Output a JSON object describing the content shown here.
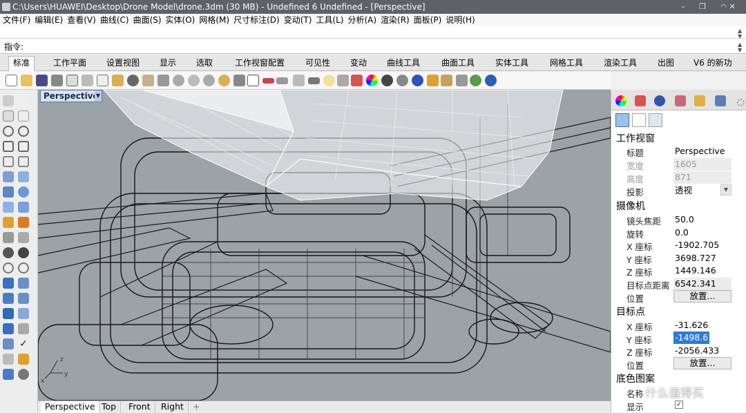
{
  "window": {
    "title": "C:\\Users\\HUAWEI\\Desktop\\Drone Model\\drone.3dm (30 MB) - Undefined 6 Undefined - [Perspective]",
    "controls": [
      "–",
      "❐",
      "✕"
    ]
  },
  "menu": [
    "文件(F)",
    "编辑(E)",
    "查看(V)",
    "曲线(C)",
    "曲面(S)",
    "实体(O)",
    "网格(M)",
    "尺寸标注(D)",
    "变动(T)",
    "工具(L)",
    "分析(A)",
    "渲染(R)",
    "面板(P)",
    "说明(H)"
  ],
  "command": {
    "label": "指令:",
    "value": ""
  },
  "ribbon_tabs": [
    "标准",
    "工作平面",
    "设置视图",
    "显示",
    "选取",
    "工作视窗配置",
    "可见性",
    "变动",
    "曲线工具",
    "曲面工具",
    "实体工具",
    "网格工具",
    "渲染工具",
    "出图",
    "V6 的新功"
  ],
  "toolbar_icons": [
    "new-icon",
    "open-icon",
    "save-icon",
    "print-icon",
    "import-icon",
    "cut-icon",
    "copy-icon",
    "paste-icon",
    "undo-icon",
    "pan-icon",
    "rotate-icon",
    "zoom-icon",
    "zoom-window-icon",
    "zoom-extents-icon",
    "zoom-selected-icon",
    "rotate-view-icon",
    "viewports-icon",
    "cplane-icon",
    "car-icon",
    "select-icon",
    "hide-icon",
    "light-icon",
    "lock-icon",
    "layer-icon",
    "color-wheel-icon",
    "sphere-render-icon",
    "material-icon",
    "globe-icon",
    "flag-icon",
    "gear-puzzle-icon",
    "dim-icon",
    "earth-icon",
    "help-icon"
  ],
  "viewport": {
    "name": "Perspective",
    "axes": {
      "x": "x",
      "y": "y",
      "z": "z"
    }
  },
  "viewport_tabs": [
    "Perspective",
    "Top",
    "Front",
    "Right"
  ],
  "panel": {
    "sections": {
      "viewport": "工作视窗",
      "camera": "摄像机",
      "target": "目标点",
      "wallpaper": "底色图案"
    },
    "viewport_props": [
      {
        "label": "标题",
        "value": "Perspective",
        "disabled": false
      },
      {
        "label": "宽度",
        "value": "1605",
        "disabled": true
      },
      {
        "label": "高度",
        "value": "871",
        "disabled": true
      },
      {
        "label": "投影",
        "value": "透视",
        "disabled": false
      }
    ],
    "camera_props": [
      {
        "label": "镜头焦距",
        "value": "50.0"
      },
      {
        "label": "旋转",
        "value": "0.0"
      },
      {
        "label": "X 座标",
        "value": "-1902.705"
      },
      {
        "label": "Y 座标",
        "value": "3698.727"
      },
      {
        "label": "Z 座标",
        "value": "1449.146"
      },
      {
        "label": "目标点距离",
        "value": "6542.341"
      },
      {
        "label": "位置",
        "button": "放置..."
      }
    ],
    "target_props": [
      {
        "label": "X 座标",
        "value": "-31.626"
      },
      {
        "label": "Y 座标",
        "value": "-1498.6",
        "selected": true
      },
      {
        "label": "Z 座标",
        "value": "-2056.433"
      },
      {
        "label": "位置",
        "button": "放置..."
      }
    ],
    "wallpaper_props": [
      {
        "label": "名称",
        "value": ""
      },
      {
        "label": "显示",
        "checked": true
      }
    ]
  },
  "watermark": "什么值得买"
}
